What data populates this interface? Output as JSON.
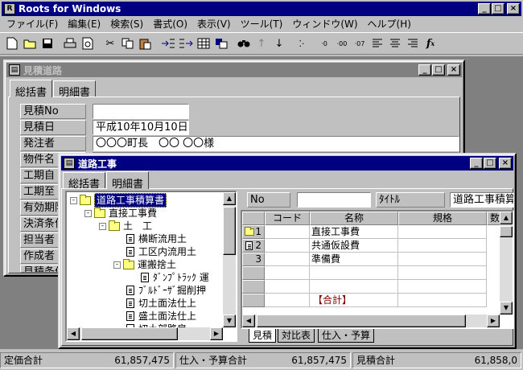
{
  "app": {
    "title": "Roots for Windows"
  },
  "menu": [
    "ファイル(F)",
    "編集(E)",
    "検索(S)",
    "書式(O)",
    "表示(V)",
    "ツール(T)",
    "ウィンドウ(W)",
    "ヘルプ(H)"
  ],
  "toolbar_icons": [
    "new-icon",
    "open-icon",
    "save-icon",
    "print-icon",
    "preview-icon",
    "cut-icon",
    "copy-icon",
    "paste-icon",
    "indent-icon",
    "outdent-icon",
    "grid-icon",
    "insert-icon",
    "search-icon",
    "up-icon",
    "down-icon",
    "dots-icon",
    "decimal-0-icon",
    "decimal-00-icon",
    "decimal-07-icon",
    "align-left-icon",
    "align-center-icon",
    "align-right-icon",
    "function-icon"
  ],
  "estimate_window": {
    "title": "見積道路",
    "tabs": [
      "総括書",
      "明細書"
    ],
    "fields": [
      {
        "label": "見積No",
        "value": ""
      },
      {
        "label": "見積日",
        "value": "平成10年10月10日"
      },
      {
        "label": "発注者",
        "value": "〇〇〇町長　〇〇 〇〇様"
      },
      {
        "label": "物件名",
        "value": ""
      },
      {
        "label": "工期自",
        "value": ""
      },
      {
        "label": "工期至",
        "value": ""
      },
      {
        "label": "有効期限",
        "value": ""
      },
      {
        "label": "決済条件",
        "value": ""
      },
      {
        "label": "担当者",
        "value": ""
      },
      {
        "label": "作成者",
        "value": ""
      },
      {
        "label": "見積条件",
        "value": ""
      }
    ]
  },
  "road_window": {
    "title": "道路工事",
    "tabs": [
      "総括書",
      "明細書"
    ],
    "tree": [
      {
        "label": "道路工事積算書",
        "level": 0,
        "type": "folder",
        "toggle": "-",
        "selected": true
      },
      {
        "label": "直接工事費",
        "level": 1,
        "type": "folder",
        "toggle": "-"
      },
      {
        "label": "土　工",
        "level": 2,
        "type": "folder",
        "toggle": "-"
      },
      {
        "label": "横断流用土",
        "level": 3,
        "type": "doc"
      },
      {
        "label": "工区内流用土",
        "level": 3,
        "type": "doc"
      },
      {
        "label": "運搬捨土",
        "level": 3,
        "type": "folder",
        "toggle": "-"
      },
      {
        "label": "ﾀﾞﾝﾌﾟﾄﾗｯｸ 運",
        "level": 4,
        "type": "doc"
      },
      {
        "label": "ﾌﾞﾙﾄﾞｰｻﾞ掘削押",
        "level": 3,
        "type": "doc"
      },
      {
        "label": "切土面法仕上",
        "level": 3,
        "type": "doc"
      },
      {
        "label": "盛土面法仕上",
        "level": 3,
        "type": "doc"
      },
      {
        "label": "切土部路肩",
        "level": 3,
        "type": "doc"
      }
    ],
    "header_fields": {
      "no_label": "No",
      "no_value": "",
      "title_label": "ﾀｲﾄﾙ",
      "title_value": "道路工事積算"
    },
    "grid": {
      "columns": [
        "コード",
        "名称",
        "規格",
        "数"
      ],
      "rows": [
        {
          "num": "1",
          "icon": "folder",
          "code": "",
          "name": "直接工事費"
        },
        {
          "num": "2",
          "icon": "doc",
          "code": "",
          "name": "共通仮設費"
        },
        {
          "num": "3",
          "icon": "",
          "code": "",
          "name": "準備費"
        },
        {
          "num": "",
          "icon": "",
          "code": "",
          "name": ""
        },
        {
          "num": "",
          "icon": "",
          "code": "",
          "name": ""
        },
        {
          "num": "",
          "icon": "",
          "code": "",
          "name": "【合計】"
        }
      ]
    },
    "bottom_tabs": [
      "見積",
      "対比表",
      "仕入・予算"
    ]
  },
  "statusbar": [
    {
      "label": "定価合計",
      "value": "61,857,475"
    },
    {
      "label": "仕入・予算合計",
      "value": "61,857,475"
    },
    {
      "label": "見積合計",
      "value": "61,858,0"
    }
  ]
}
